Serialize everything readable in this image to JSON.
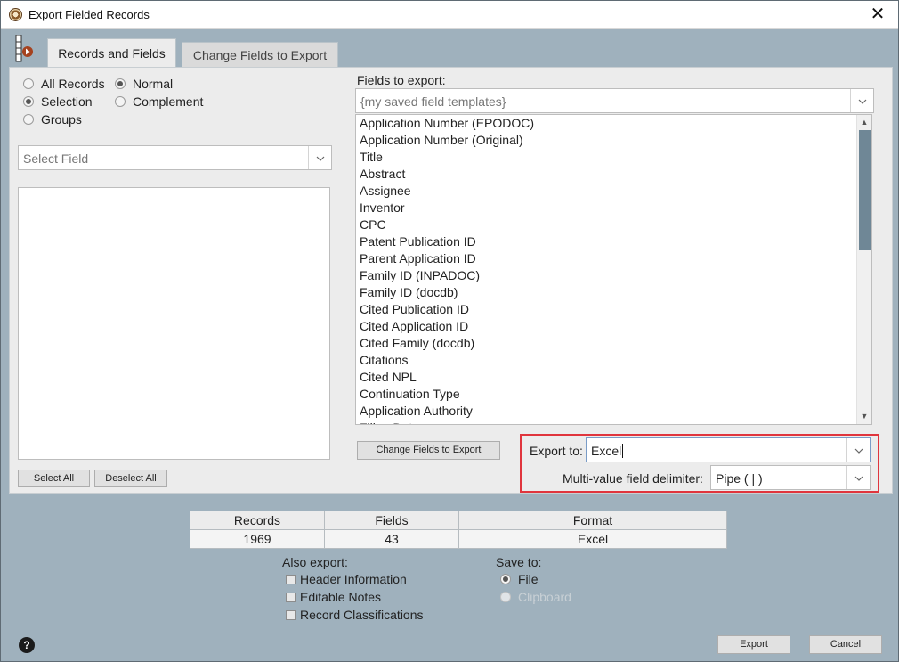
{
  "window": {
    "title": "Export Fielded Records",
    "close_glyph": "✕"
  },
  "tabs": [
    {
      "label": "Records and Fields"
    },
    {
      "label": "Change Fields to Export"
    }
  ],
  "record_scope": {
    "options": [
      "All Records",
      "Selection",
      "Groups"
    ],
    "selected": "Selection"
  },
  "selection_mode": {
    "options": [
      "Normal",
      "Complement"
    ],
    "selected": "Normal"
  },
  "select_field": {
    "placeholder": "Select Field"
  },
  "left_buttons": {
    "select_all": "Select All",
    "deselect_all": "Deselect All"
  },
  "fields_to_export": {
    "label": "Fields to export:",
    "template_placeholder": "{my saved field templates}",
    "items": [
      "Application Number (EPODOC)",
      "Application Number (Original)",
      "Title",
      "Abstract",
      "Assignee",
      "Inventor",
      "CPC",
      "Patent Publication ID",
      "Parent Application ID",
      "Family ID (INPADOC)",
      "Family ID (docdb)",
      "Cited Publication ID",
      "Cited Application ID",
      "Cited Family (docdb)",
      "Citations",
      "Cited NPL",
      "Continuation Type",
      "Application Authority",
      "Filing Date"
    ],
    "change_button": "Change Fields to Export"
  },
  "export_options": {
    "export_to_label": "Export to:",
    "export_to_value": "Excel",
    "delimiter_label": "Multi-value field delimiter:",
    "delimiter_value": "Pipe ( | )",
    "highlight_color": "#e0353d"
  },
  "summary": {
    "headers": [
      "Records",
      "Fields",
      "Format"
    ],
    "values": [
      "1969",
      "43",
      "Excel"
    ]
  },
  "also_export": {
    "label": "Also export:",
    "items": [
      "Header Information",
      "Editable Notes",
      "Record Classifications"
    ]
  },
  "save_to": {
    "label": "Save to:",
    "options": [
      "File",
      "Clipboard"
    ],
    "selected": "File"
  },
  "footer": {
    "help": "?",
    "export_button": "Export",
    "cancel_button": "Cancel"
  }
}
